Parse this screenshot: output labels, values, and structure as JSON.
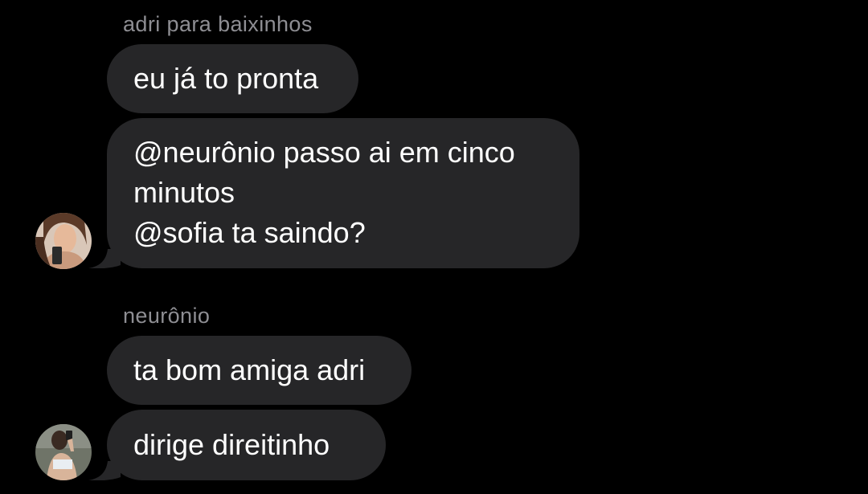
{
  "colors": {
    "background": "#000000",
    "bubble": "#262628",
    "sender_name": "#8e8e93",
    "text": "#ffffff"
  },
  "group1": {
    "sender": "adri para baixinhos",
    "messages": [
      {
        "lines": [
          "eu já to pronta"
        ]
      },
      {
        "lines": [
          "@neurônio passo ai em cinco",
          "minutos",
          "@sofia ta saindo?"
        ]
      }
    ]
  },
  "group2": {
    "sender": "neurônio",
    "messages": [
      {
        "lines": [
          "ta bom amiga adri"
        ]
      },
      {
        "lines": [
          "dirige direitinho"
        ]
      }
    ]
  },
  "icons": {
    "avatar1": "profile-photo-avatar",
    "avatar2": "profile-photo-avatar"
  }
}
